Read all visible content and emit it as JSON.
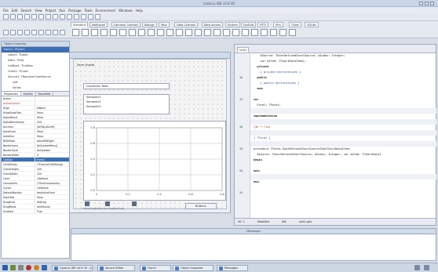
{
  "window": {
    "title": "Lazarus IDE v0.9.30"
  },
  "menu": [
    "File",
    "Edit",
    "Search",
    "View",
    "Project",
    "Run",
    "Package",
    "Tools",
    "Environment",
    "Windows",
    "Help"
  ],
  "palette_tabs": [
    {
      "label": "Standard",
      "active": true
    },
    {
      "label": "Additional",
      "active": false
    },
    {
      "label": "Common Controls",
      "active": false
    },
    {
      "label": "Dialogs",
      "active": false
    },
    {
      "label": "Misc",
      "active": false
    },
    {
      "label": "Data Controls",
      "active": false
    },
    {
      "label": "Data Access",
      "active": false
    },
    {
      "label": "System",
      "active": false
    },
    {
      "label": "SynEdit",
      "active": false
    },
    {
      "label": "RTTI",
      "active": false
    },
    {
      "label": "IPro",
      "active": false
    },
    {
      "label": "Chart",
      "active": false
    },
    {
      "label": "SQLdb",
      "active": false
    }
  ],
  "object_inspector": {
    "title": "Object Inspector",
    "tree": [
      {
        "label": "Form1: TForm1",
        "selected": true
      },
      {
        "label": "Label1: TLabel",
        "selected": false
      },
      {
        "label": "Edit1: TEdit",
        "selected": false
      },
      {
        "label": "ListBox1: TListBox",
        "selected": false
      },
      {
        "label": "Chart1: TChart",
        "selected": false
      },
      {
        "label": "Source1: TRandomChartSource",
        "selected": false
      },
      {
        "label": "Left",
        "selected": false
      },
      {
        "label": "Series",
        "selected": false
      }
    ],
    "tabs": [
      {
        "label": "Properties",
        "active": true
      },
      {
        "label": "Events",
        "active": false
      },
      {
        "label": "Favorites",
        "active": false
      }
    ],
    "props": [
      {
        "k": "Action",
        "v": "",
        "red": false
      },
      {
        "k": "ActiveControl",
        "v": "",
        "red": true
      },
      {
        "k": "Align",
        "v": "alNone",
        "red": false
      },
      {
        "k": "AllowDropFiles",
        "v": "False",
        "red": false
      },
      {
        "k": "AlphaBlend",
        "v": "False",
        "red": false
      },
      {
        "k": "AlphaBlendValue",
        "v": "255",
        "red": false
      },
      {
        "k": "Anchors",
        "v": "[akTop,akLeft]",
        "red": false
      },
      {
        "k": "AutoScroll",
        "v": "False",
        "red": false
      },
      {
        "k": "AutoSize",
        "v": "False",
        "red": false
      },
      {
        "k": "BiDiMode",
        "v": "bdLeftToRight",
        "red": false
      },
      {
        "k": "BorderIcons",
        "v": "[biSystemMenu]",
        "red": false
      },
      {
        "k": "BorderStyle",
        "v": "bsSizeable",
        "red": false
      },
      {
        "k": "BorderWidth",
        "v": "0",
        "red": false
      },
      {
        "k": "Caption",
        "v": "Form1",
        "red": false
      },
      {
        "k": "ChildSizing",
        "v": "(TControlChildSizing)",
        "red": false
      },
      {
        "k": "ClientHeight",
        "v": "240",
        "red": false
      },
      {
        "k": "ClientWidth",
        "v": "320",
        "red": false
      },
      {
        "k": "Color",
        "v": "clDefault",
        "red": false
      },
      {
        "k": "Constraints",
        "v": "(TSizeConstraints)",
        "red": false
      },
      {
        "k": "Cursor",
        "v": "crDefault",
        "red": false
      },
      {
        "k": "DefaultMonitor",
        "v": "dmActiveForm",
        "red": false
      },
      {
        "k": "DockSite",
        "v": "False",
        "red": false
      },
      {
        "k": "DragKind",
        "v": "dkDrag",
        "red": false
      },
      {
        "k": "DragMode",
        "v": "dmManual",
        "red": false
      },
      {
        "k": "Enabled",
        "v": "True",
        "red": false
      }
    ]
  },
  "form_designer": {
    "title": "Form1",
    "caption": "Form Huntb",
    "combo_value": "Connector Tools",
    "list_items": [
      "Semantic1",
      "Semantic2",
      "Semantic3"
    ],
    "close_button": "Button1",
    "bottom_text": "Form1 ChartSource1 ChartSource2"
  },
  "chart_data": {
    "type": "line",
    "title": "",
    "xlabel": "",
    "ylabel": "",
    "x_ticks": [
      "0",
      "0.2",
      "0.4",
      "0.6",
      "0.8"
    ],
    "y_ticks": [
      "0.0",
      "0.2",
      "0.4",
      "0.6",
      "0.8"
    ],
    "series": []
  },
  "editor": {
    "tabs": [
      {
        "label": "Unit1",
        "active": true
      }
    ],
    "lines": [
      {
        "n": "",
        "t": "    ASource: TUserDefinedChartSource; AIndex: Integer;",
        "cls": ""
      },
      {
        "n": "",
        "t": "    var AItem: TChartDataItem);",
        "cls": ""
      },
      {
        "n": "",
        "t": "  private",
        "cls": "kw"
      },
      {
        "n": "",
        "t": "    { private declarations }",
        "cls": "blue"
      },
      {
        "n": "30",
        "t": "  public",
        "cls": "kw"
      },
      {
        "n": "",
        "t": "    { public declarations }",
        "cls": "blue"
      },
      {
        "n": "",
        "t": "  end;",
        "cls": "kw"
      },
      {
        "n": "",
        "t": "",
        "cls": ""
      },
      {
        "n": "35",
        "t": "var",
        "cls": "kw"
      },
      {
        "n": "",
        "t": "  Form1: TForm1;",
        "cls": ""
      },
      {
        "n": "",
        "t": "",
        "cls": "band"
      },
      {
        "n": "",
        "t": "implementation",
        "cls": "kw"
      },
      {
        "n": "",
        "t": "",
        "cls": "band"
      },
      {
        "n": "40",
        "t": "{$R *.lfm}",
        "cls": "dir"
      },
      {
        "n": "",
        "t": "",
        "cls": "band"
      },
      {
        "n": "",
        "t": "{ TForm1 }",
        "cls": "blue"
      },
      {
        "n": "",
        "t": "",
        "cls": "band"
      },
      {
        "n": "45",
        "t": "procedure TForm1.UserDefinedChartSource1GetChartDataItem(",
        "cls": ""
      },
      {
        "n": "",
        "t": "  ASource: TUserDefinedChartSource; AIndex: Integer; var AItem: TChartDataI",
        "cls": ""
      },
      {
        "n": "",
        "t": "begin",
        "cls": "kw"
      },
      {
        "n": "",
        "t": "",
        "cls": ""
      },
      {
        "n": "50",
        "t": "end;",
        "cls": "kw"
      },
      {
        "n": "",
        "t": "",
        "cls": "band"
      },
      {
        "n": "",
        "t": "end.",
        "cls": "kw"
      },
      {
        "n": "",
        "t": "",
        "cls": ""
      },
      {
        "n": "55",
        "t": "",
        "cls": ""
      }
    ],
    "status": {
      "position": "40:  1",
      "mode": "Modified",
      "ins": "INS",
      "file": "unit1.pas"
    }
  },
  "messages": {
    "title": "Messages"
  },
  "taskbar": {
    "tasks": [
      "Lazarus IDE v0.9.30 - p...",
      "Source Editor",
      "Form1",
      "Object Inspector",
      "Messages"
    ]
  }
}
